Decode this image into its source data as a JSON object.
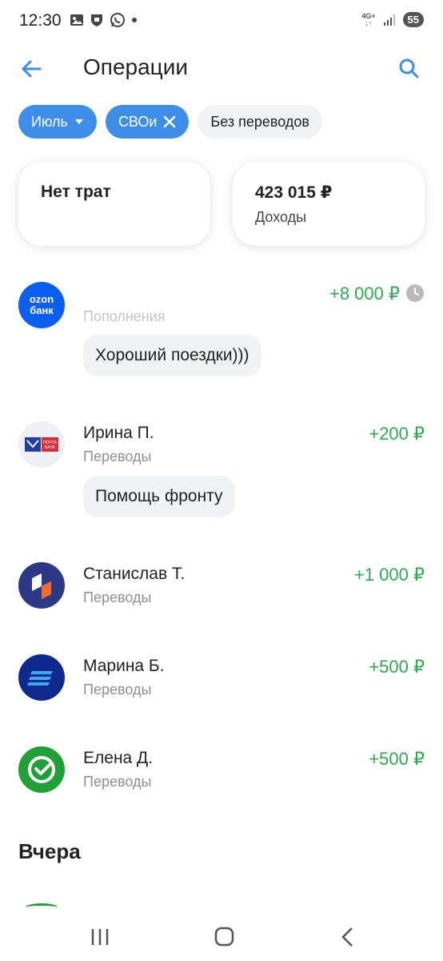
{
  "status_bar": {
    "time": "12:30",
    "battery": "55",
    "network": "4G+"
  },
  "header": {
    "title": "Операции"
  },
  "filters": {
    "month": "Июль",
    "tag": "СВОи",
    "no_transfers": "Без переводов"
  },
  "summary": {
    "expenses_title": "Нет трат",
    "income_amount": "423 015 ₽",
    "income_label": "Доходы"
  },
  "transactions": [
    {
      "name": "",
      "category": "Пополнения",
      "amount": "+8 000 ₽",
      "note": "Хороший поездки)))",
      "bank": "ozon",
      "bank_label_1": "ozon",
      "bank_label_2": "банк"
    },
    {
      "name": "Ирина П.",
      "category": "Переводы",
      "amount": "+200 ₽",
      "note": "Помощь фронту",
      "bank": "pochta",
      "bank_label_1": "ПОЧТА",
      "bank_label_2": "БАНК"
    },
    {
      "name": "Станислав Т.",
      "category": "Переводы",
      "amount": "+1 000 ₽",
      "bank": "psb"
    },
    {
      "name": "Марина Б.",
      "category": "Переводы",
      "amount": "+500 ₽",
      "bank": "vtb"
    },
    {
      "name": "Елена Д.",
      "category": "Переводы",
      "amount": "+500 ₽",
      "bank": "sber"
    }
  ],
  "sections": {
    "yesterday": "Вчера"
  },
  "colors": {
    "accent": "#3e8ee8",
    "income": "#2fa84f"
  }
}
